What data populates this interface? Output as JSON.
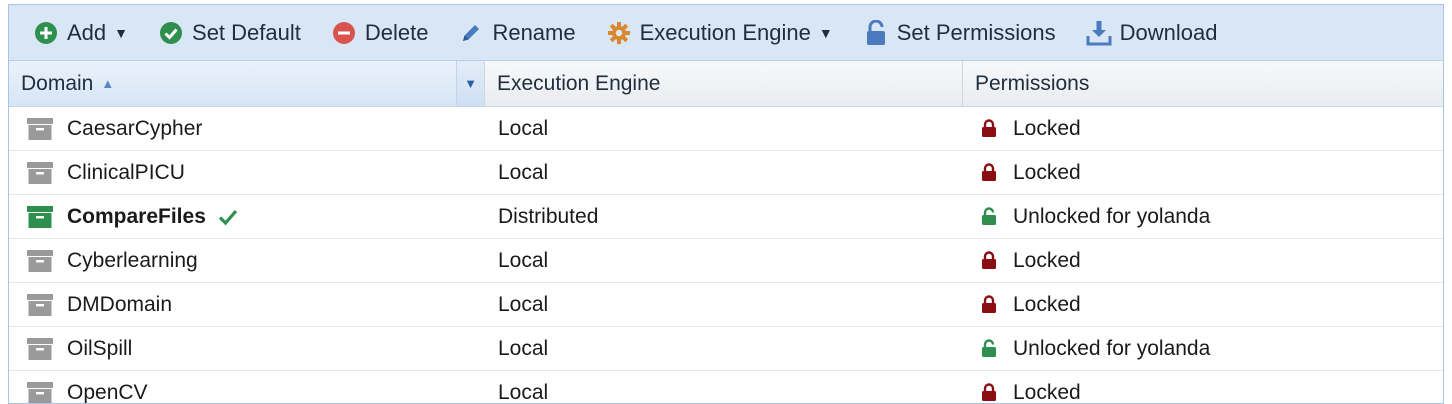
{
  "toolbar": {
    "add_label": "Add",
    "set_default_label": "Set Default",
    "delete_label": "Delete",
    "rename_label": "Rename",
    "execution_engine_label": "Execution Engine",
    "set_permissions_label": "Set Permissions",
    "download_label": "Download"
  },
  "columns": {
    "domain": "Domain",
    "engine": "Execution Engine",
    "permissions": "Permissions"
  },
  "rows": [
    {
      "name": "CaesarCypher",
      "engine": "Local",
      "permission": "Locked",
      "locked": true,
      "default": false
    },
    {
      "name": "ClinicalPICU",
      "engine": "Local",
      "permission": "Locked",
      "locked": true,
      "default": false
    },
    {
      "name": "CompareFiles",
      "engine": "Distributed",
      "permission": "Unlocked for yolanda",
      "locked": false,
      "default": true
    },
    {
      "name": "Cyberlearning",
      "engine": "Local",
      "permission": "Locked",
      "locked": true,
      "default": false
    },
    {
      "name": "DMDomain",
      "engine": "Local",
      "permission": "Locked",
      "locked": true,
      "default": false
    },
    {
      "name": "OilSpill",
      "engine": "Local",
      "permission": "Unlocked for yolanda",
      "locked": false,
      "default": false
    },
    {
      "name": "OpenCV",
      "engine": "Local",
      "permission": "Locked",
      "locked": true,
      "default": false
    }
  ],
  "colors": {
    "locked": "#8b0e12",
    "unlocked": "#2f8f4e",
    "default_box": "#2f8f4e",
    "box": "#9a9a9a"
  }
}
